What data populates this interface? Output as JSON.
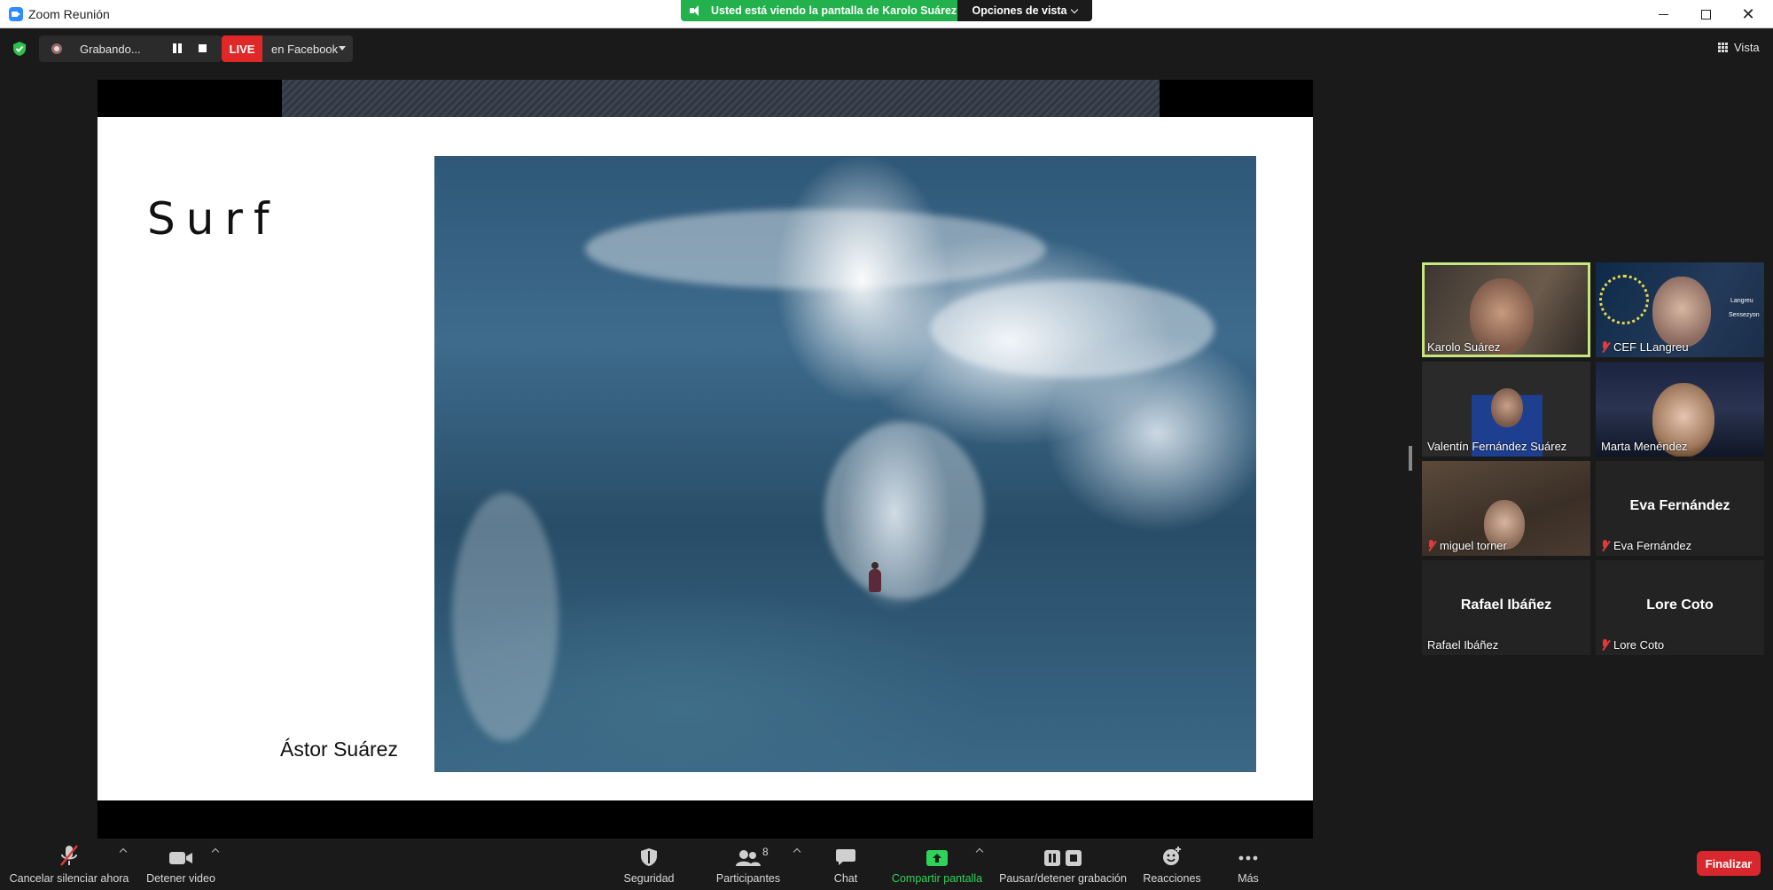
{
  "window": {
    "title": "Zoom Reunión"
  },
  "banner": {
    "text": "Usted está viendo la pantalla de Karolo Suárez",
    "view_options": "Opciones de vista"
  },
  "recording": {
    "status": "Grabando...",
    "live_badge": "LIVE",
    "live_destination": "en Facebook"
  },
  "view_button": "Vista",
  "slide": {
    "title": "Surf",
    "author": "Ástor Suárez"
  },
  "participants": [
    {
      "name": "Karolo Suárez",
      "muted": false,
      "video": true,
      "active": true
    },
    {
      "name": "CEF LLangreu",
      "muted": true,
      "video": true,
      "active": false
    },
    {
      "name": "Valentín Fernández Suárez",
      "muted": false,
      "video": true,
      "active": false
    },
    {
      "name": "Marta Menéndez",
      "muted": false,
      "video": true,
      "active": false
    },
    {
      "name": "miguel torner",
      "muted": true,
      "video": true,
      "active": false
    },
    {
      "name": "Eva Fernández",
      "muted": true,
      "video": false,
      "active": false
    },
    {
      "name": "Rafael Ibáñez",
      "muted": false,
      "video": false,
      "active": false
    },
    {
      "name": "Lore Coto",
      "muted": true,
      "video": false,
      "active": false
    }
  ],
  "cef_logo_text": {
    "line1": "Langreu",
    "line2": "Sensezyon"
  },
  "toolbar": {
    "unmute": "Cancelar silenciar ahora",
    "stop_video": "Detener video",
    "security": "Seguridad",
    "participants": "Participantes",
    "participants_count": "8",
    "chat": "Chat",
    "share": "Compartir pantalla",
    "pause_recording": "Pausar/detener grabación",
    "reactions": "Reacciones",
    "more": "Más",
    "end": "Finalizar"
  },
  "colors": {
    "share_green": "#22b14c",
    "live_red": "#e02828",
    "end_red": "#d9272e",
    "active_speaker": "#c8e680"
  }
}
